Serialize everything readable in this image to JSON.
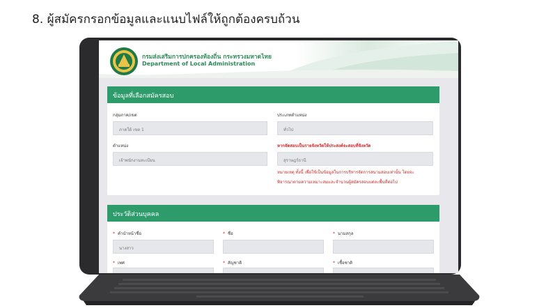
{
  "instruction": "8. ผู้สมัครกรอกข้อมูลและแนบไฟล์ให้ถูกต้องครบถ้วน",
  "header": {
    "org_thai": "กรมส่งเสริมการปกครองท้องถิ่น กระทรวงมหาดไทย",
    "org_en": "Department of Local Administration"
  },
  "exam_section": {
    "title": "ข้อมูลที่เลือกสมัครสอบ",
    "group_label": "กลุ่มภาค/เขต",
    "group_value": "ภาคใต้ เขต 1",
    "position_type_label": "ประเภทตำแหน่ง",
    "position_type_value": "ทั่วไป",
    "position_label": "ตำแหน่ง",
    "position_value": "เจ้าพนักงานทะเบียน",
    "province_label": "หากจัดสอบเป็นรายจังหวัดให้ประสงค์จะสอบที่จังหวัด",
    "province_value": "สุราษฎร์ธานี",
    "note_line1": "หมายเหตุ ทั้งนี้ เพื่อใช้เป็นข้อมูลในการบริหารจัดการสนามสอบเท่านั้น โดยจะ",
    "note_line2": "พิจารณาตามความเหมาะสมและจำนวนผู้สมัครสอบแต่ละพื้นที่ต่อไป"
  },
  "personal_section": {
    "title": "ประวัติส่วนบุคคล",
    "prefix_label": "คำนำหน้าชื่อ",
    "prefix_value": "นางสาว",
    "firstname_label": "ชื่อ",
    "firstname_value": "",
    "lastname_label": "นามสกุล",
    "lastname_value": "",
    "gender_label": "เพศ",
    "ethnicity_label": "สัญชาติ",
    "nationality_label": "เชื้อชาติ",
    "required_mark": "*"
  },
  "colors": {
    "section_bar": "#2e9b6b",
    "brand_green": "#2c8a58",
    "note_red": "#d42424"
  }
}
